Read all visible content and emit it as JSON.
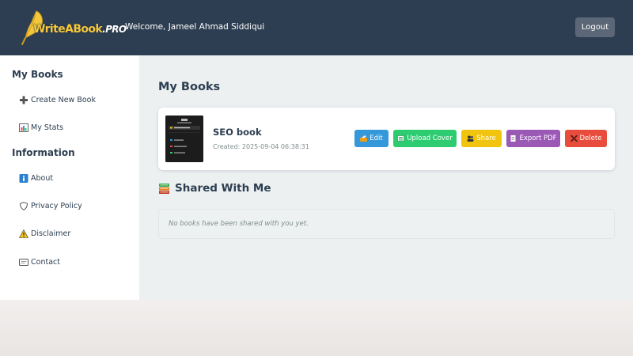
{
  "header": {
    "logo_text": "WriteABook",
    "logo_suffix": ".PRO",
    "welcome": "Welcome, Jameel Ahmad Siddiqui",
    "logout_label": "Logout"
  },
  "sidebar": {
    "sections": [
      {
        "heading": "My Books",
        "items": [
          {
            "label": "Create New Book",
            "icon": "plus-icon"
          },
          {
            "label": "My Stats",
            "icon": "bar-chart-icon"
          }
        ]
      },
      {
        "heading": "Information",
        "items": [
          {
            "label": "About",
            "icon": "info-icon"
          },
          {
            "label": "Privacy Policy",
            "icon": "shield-icon"
          },
          {
            "label": "Disclaimer",
            "icon": "warning-icon"
          },
          {
            "label": "Contact",
            "icon": "contact-card-icon"
          }
        ]
      }
    ]
  },
  "main": {
    "title": "My Books",
    "books": [
      {
        "title": "SEO book",
        "created": "Created: 2025-09-04 06:38:31",
        "actions": [
          {
            "label": "Edit",
            "color": "#3498db",
            "icon": "pencil-icon"
          },
          {
            "label": "Upload Cover",
            "color": "#2ecc71",
            "icon": "image-icon"
          },
          {
            "label": "Share",
            "color": "#f1c40f",
            "icon": "share-icon"
          },
          {
            "label": "Export PDF",
            "color": "#9b59b6",
            "icon": "pdf-icon"
          },
          {
            "label": "Delete",
            "color": "#e74c3c",
            "icon": "delete-icon"
          }
        ]
      }
    ],
    "shared": {
      "title": "Shared With Me",
      "icon": "books-icon",
      "empty_message": "No books have been shared with you yet."
    }
  },
  "colors": {
    "header_bg": "#2e3e52",
    "main_bg": "#ecf0f1",
    "text_dark": "#2c3e50",
    "logo_gold": "#f5c83c"
  }
}
